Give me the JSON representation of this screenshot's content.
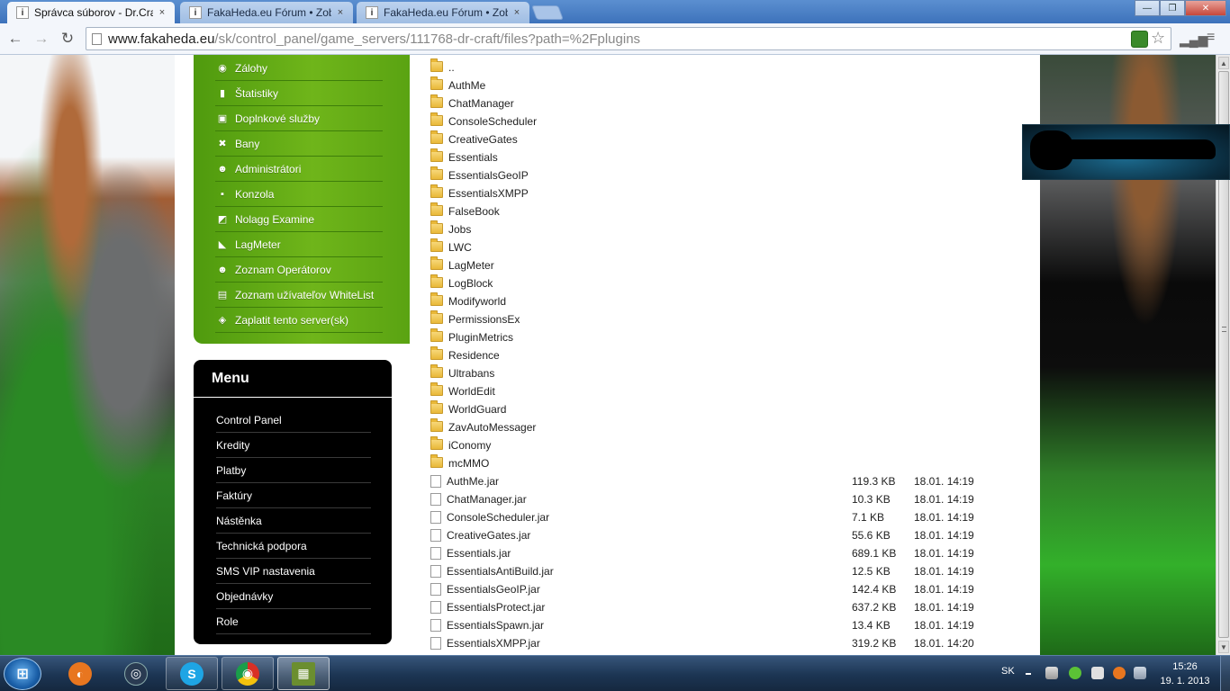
{
  "browser": {
    "tabs": [
      {
        "title": "Správca súborov - Dr.Craft",
        "close": "×"
      },
      {
        "title": "FakaHeda.eu Fórum • Zob",
        "close": "×"
      },
      {
        "title": "FakaHeda.eu Fórum • Zob",
        "close": "×"
      }
    ],
    "window_controls": {
      "minimize": "—",
      "maximize": "❐",
      "close": "✕"
    },
    "nav": {
      "back": "←",
      "forward": "→",
      "reload": "↻"
    },
    "url_host": "www.fakaheda.eu",
    "url_path": "/sk/control_panel/game_servers/111768-dr-craft/files?path=%2Fplugins",
    "star": "☆"
  },
  "green_menu": [
    {
      "label": "Zálohy",
      "icon": "backup-disc-icon",
      "glyph": "◉"
    },
    {
      "label": "Štatistiky",
      "icon": "statistics-chart-icon",
      "glyph": "▮"
    },
    {
      "label": "Doplnkové služby",
      "icon": "gift-icon",
      "glyph": "▣"
    },
    {
      "label": "Bany",
      "icon": "ban-x-icon",
      "glyph": "✖"
    },
    {
      "label": "Administrátori",
      "icon": "admin-user-icon",
      "glyph": "☻"
    },
    {
      "label": "Konzola",
      "icon": "console-icon",
      "glyph": "▪"
    },
    {
      "label": "Nolagg Examine",
      "icon": "examine-chart-icon",
      "glyph": "◩"
    },
    {
      "label": "LagMeter",
      "icon": "lagmeter-icon",
      "glyph": "◣"
    },
    {
      "label": "Zoznam Operátorov",
      "icon": "operator-user-icon",
      "glyph": "☻"
    },
    {
      "label": "Zoznam užívateľov WhiteList",
      "icon": "whitelist-clipboard-icon",
      "glyph": "▤"
    },
    {
      "label": "Zaplatit tento server(sk)",
      "icon": "pay-money-icon",
      "glyph": "◈"
    }
  ],
  "black_menu": {
    "title": "Menu",
    "items": [
      "Control Panel",
      "Kredity",
      "Platby",
      "Faktúry",
      "Nástěnka",
      "Technická podpora",
      "SMS VIP nastavenia",
      "Objednávky",
      "Role"
    ]
  },
  "files": [
    {
      "name": "..",
      "type": "folder",
      "size": "",
      "date": ""
    },
    {
      "name": "AuthMe",
      "type": "folder",
      "size": "",
      "date": ""
    },
    {
      "name": "ChatManager",
      "type": "folder",
      "size": "",
      "date": ""
    },
    {
      "name": "ConsoleScheduler",
      "type": "folder",
      "size": "",
      "date": ""
    },
    {
      "name": "CreativeGates",
      "type": "folder",
      "size": "",
      "date": ""
    },
    {
      "name": "Essentials",
      "type": "folder",
      "size": "",
      "date": ""
    },
    {
      "name": "EssentialsGeoIP",
      "type": "folder",
      "size": "",
      "date": ""
    },
    {
      "name": "EssentialsXMPP",
      "type": "folder",
      "size": "",
      "date": ""
    },
    {
      "name": "FalseBook",
      "type": "folder",
      "size": "",
      "date": ""
    },
    {
      "name": "Jobs",
      "type": "folder",
      "size": "",
      "date": ""
    },
    {
      "name": "LWC",
      "type": "folder",
      "size": "",
      "date": ""
    },
    {
      "name": "LagMeter",
      "type": "folder",
      "size": "",
      "date": ""
    },
    {
      "name": "LogBlock",
      "type": "folder",
      "size": "",
      "date": ""
    },
    {
      "name": "Modifyworld",
      "type": "folder",
      "size": "",
      "date": ""
    },
    {
      "name": "PermissionsEx",
      "type": "folder",
      "size": "",
      "date": ""
    },
    {
      "name": "PluginMetrics",
      "type": "folder",
      "size": "",
      "date": ""
    },
    {
      "name": "Residence",
      "type": "folder",
      "size": "",
      "date": ""
    },
    {
      "name": "Ultrabans",
      "type": "folder",
      "size": "",
      "date": ""
    },
    {
      "name": "WorldEdit",
      "type": "folder",
      "size": "",
      "date": ""
    },
    {
      "name": "WorldGuard",
      "type": "folder",
      "size": "",
      "date": ""
    },
    {
      "name": "ZavAutoMessager",
      "type": "folder",
      "size": "",
      "date": ""
    },
    {
      "name": "iConomy",
      "type": "folder",
      "size": "",
      "date": ""
    },
    {
      "name": "mcMMO",
      "type": "folder",
      "size": "",
      "date": ""
    },
    {
      "name": "AuthMe.jar",
      "type": "file",
      "size": "119.3 KB",
      "date": "18.01. 14:19"
    },
    {
      "name": "ChatManager.jar",
      "type": "file",
      "size": "10.3 KB",
      "date": "18.01. 14:19"
    },
    {
      "name": "ConsoleScheduler.jar",
      "type": "file",
      "size": "7.1 KB",
      "date": "18.01. 14:19"
    },
    {
      "name": "CreativeGates.jar",
      "type": "file",
      "size": "55.6 KB",
      "date": "18.01. 14:19"
    },
    {
      "name": "Essentials.jar",
      "type": "file",
      "size": "689.1 KB",
      "date": "18.01. 14:19"
    },
    {
      "name": "EssentialsAntiBuild.jar",
      "type": "file",
      "size": "12.5 KB",
      "date": "18.01. 14:19"
    },
    {
      "name": "EssentialsGeoIP.jar",
      "type": "file",
      "size": "142.4 KB",
      "date": "18.01. 14:19"
    },
    {
      "name": "EssentialsProtect.jar",
      "type": "file",
      "size": "637.2 KB",
      "date": "18.01. 14:19"
    },
    {
      "name": "EssentialsSpawn.jar",
      "type": "file",
      "size": "13.4 KB",
      "date": "18.01. 14:19"
    },
    {
      "name": "EssentialsXMPP.jar",
      "type": "file",
      "size": "319.2 KB",
      "date": "18.01. 14:20"
    }
  ],
  "taskbar": {
    "start_glyph": "⊞",
    "buttons": [
      {
        "name": "firefox",
        "glyph": "◐",
        "color": "#e8761f"
      },
      {
        "name": "steam",
        "glyph": "◎",
        "color": "#2a3b52"
      },
      {
        "name": "skype",
        "glyph": "S",
        "color": "#1ea5e5"
      },
      {
        "name": "chrome",
        "glyph": "◉",
        "color": "#d9a21c"
      },
      {
        "name": "minecraft",
        "glyph": "▦",
        "color": "#6b8e2f"
      }
    ],
    "language": "SK",
    "time": "15:26",
    "date": "19. 1. 2013"
  }
}
